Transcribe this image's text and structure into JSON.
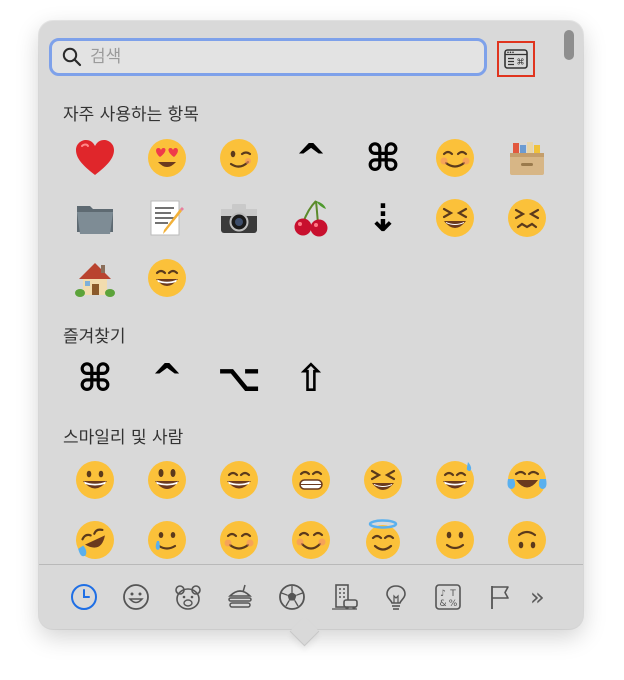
{
  "search": {
    "placeholder": "검색",
    "value": ""
  },
  "sections": {
    "frequently_used": {
      "title": "자주 사용하는 항목",
      "rows": [
        [
          {
            "icon": "red-heart",
            "glyph": "❤️"
          },
          {
            "icon": "heart-eyes-face",
            "glyph": "😍"
          },
          {
            "icon": "winking-face",
            "glyph": "😉"
          },
          {
            "icon": "control-key-symbol",
            "glyph": "^"
          },
          {
            "icon": "command-key-symbol",
            "glyph": "⌘"
          },
          {
            "icon": "smiling-face",
            "glyph": "☺️"
          },
          {
            "icon": "card-file-box",
            "glyph": "🗃️"
          }
        ],
        [
          {
            "icon": "file-folder",
            "glyph": "📁"
          },
          {
            "icon": "memo",
            "glyph": "📝"
          },
          {
            "icon": "camera",
            "glyph": "📷"
          },
          {
            "icon": "cherries",
            "glyph": "🍒"
          },
          {
            "icon": "dotted-down-arrow",
            "glyph": "⇣"
          },
          {
            "icon": "squinting-face",
            "glyph": "😆"
          },
          {
            "icon": "confounded-face",
            "glyph": "😣"
          }
        ],
        [
          {
            "icon": "house-with-garden",
            "glyph": "🏡"
          },
          {
            "icon": "beaming-face",
            "glyph": "😁"
          }
        ]
      ]
    },
    "favorites": {
      "title": "즐겨찾기",
      "rows": [
        [
          {
            "icon": "command-key-symbol",
            "glyph": "⌘"
          },
          {
            "icon": "control-key-symbol",
            "glyph": "^"
          },
          {
            "icon": "option-key-symbol",
            "glyph": "⌥"
          },
          {
            "icon": "shift-key-symbol",
            "glyph": "⇧"
          }
        ]
      ]
    },
    "smileys": {
      "title": "스마일리 및 사람",
      "rows": [
        [
          {
            "icon": "grinning-face",
            "glyph": "😀"
          },
          {
            "icon": "grinning-face-big-eyes",
            "glyph": "😃"
          },
          {
            "icon": "grinning-face-smiling-eyes",
            "glyph": "😄"
          },
          {
            "icon": "beaming-face",
            "glyph": "😁"
          },
          {
            "icon": "squinting-face",
            "glyph": "😆"
          },
          {
            "icon": "grinning-face-sweat",
            "glyph": "😅"
          },
          {
            "icon": "tears-of-joy-face",
            "glyph": "😂"
          }
        ],
        [
          {
            "icon": "rolling-laughing-face",
            "glyph": "🤣"
          },
          {
            "icon": "holding-back-tears-face",
            "glyph": "🥲"
          },
          {
            "icon": "smiling-face",
            "glyph": "☺️"
          },
          {
            "icon": "smiling-face-smiling-eyes",
            "glyph": "😊"
          },
          {
            "icon": "halo-face",
            "glyph": "😇"
          },
          {
            "icon": "slightly-smiling-face",
            "glyph": "🙂"
          },
          {
            "icon": "upside-down-face",
            "glyph": "🙃"
          }
        ]
      ]
    }
  },
  "toolbar": {
    "items": [
      "recent-clock-icon",
      "smiley-icon",
      "animal-nature-icon",
      "food-drink-icon",
      "activity-ball-icon",
      "travel-places-icon",
      "objects-bulb-icon",
      "symbols-icon",
      "flags-icon"
    ],
    "more": "»"
  },
  "colors": {
    "accent": "#1f6fe5",
    "popover": "#d9d9d9",
    "search_border": "#7ea1ea",
    "highlight": "#e0341e"
  }
}
